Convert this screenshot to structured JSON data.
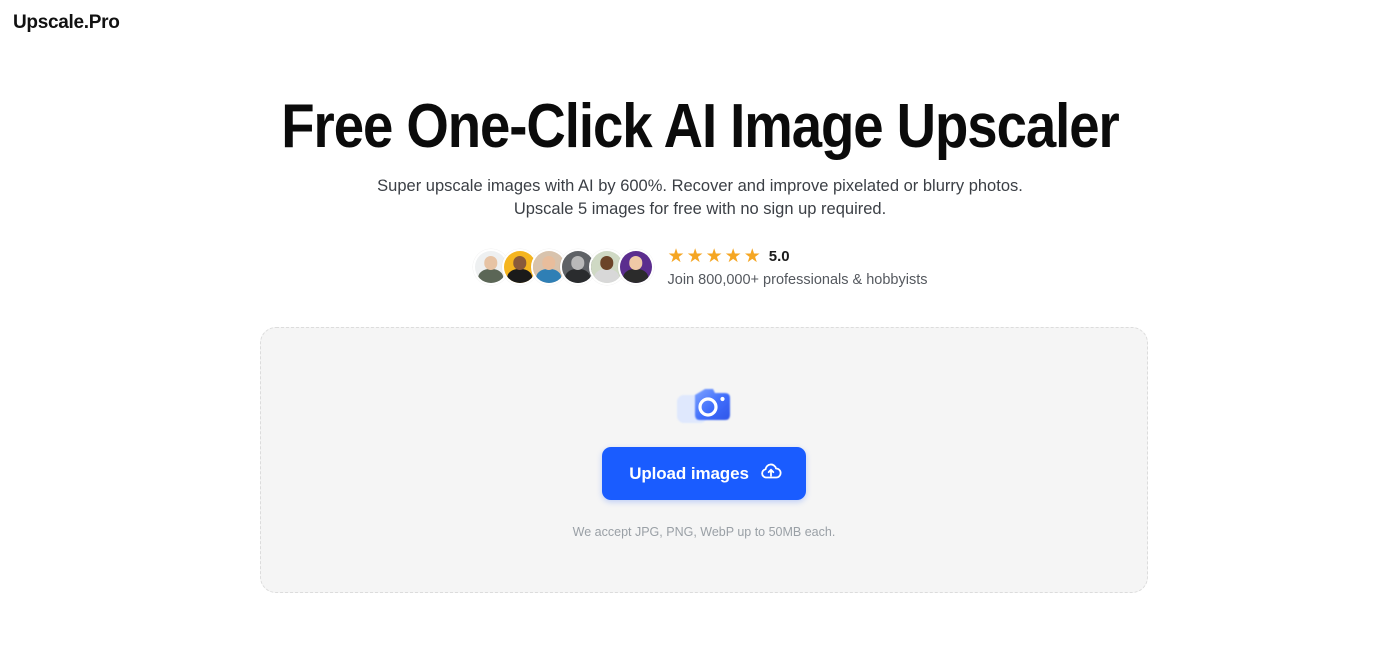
{
  "header": {
    "logo": "Upscale.Pro"
  },
  "hero": {
    "headline": "Free One-Click AI Image Upscaler",
    "subhead_line1": "Super upscale images with AI by 600%. Recover and improve pixelated or blurry photos.",
    "subhead_line2": "Upscale 5 images for free with no sign up required."
  },
  "social_proof": {
    "score": "5.0",
    "stars": [
      "★",
      "★",
      "★",
      "★",
      "★"
    ],
    "star_count": 5,
    "join_text": "Join 800,000+ professionals & hobbyists",
    "avatars": [
      {
        "name": "avatar-1",
        "bg": "#eef0f1",
        "skin": "#e7c3a4",
        "shirt": "#5b6656"
      },
      {
        "name": "avatar-2",
        "bg": "#f5b51f",
        "skin": "#8a5a3b",
        "shirt": "#1a1a1a"
      },
      {
        "name": "avatar-3",
        "bg": "#d8c3ad",
        "skin": "#e8bd9c",
        "shirt": "#2f7fb5"
      },
      {
        "name": "avatar-4",
        "bg": "#5f6266",
        "skin": "#b9b9b9",
        "shirt": "#2a2c2e"
      },
      {
        "name": "avatar-5",
        "bg": "#cfd9c4",
        "skin": "#6b4428",
        "shirt": "#d8d8d8"
      },
      {
        "name": "avatar-6",
        "bg": "#5b2d8e",
        "skin": "#efc9a6",
        "shirt": "#2b2b2b"
      }
    ]
  },
  "upload": {
    "button_label": "Upload images",
    "accept_note": "We accept JPG, PNG, WebP up to 50MB each.",
    "icon_name": "camera-photo-icon",
    "button_icon_name": "cloud-upload-icon"
  },
  "colors": {
    "accent_blue": "#1a5cff",
    "star_orange": "#f5a623",
    "card_bg": "#f5f5f5",
    "card_border": "#dcdcdc",
    "page_bg": "#ffffff"
  }
}
